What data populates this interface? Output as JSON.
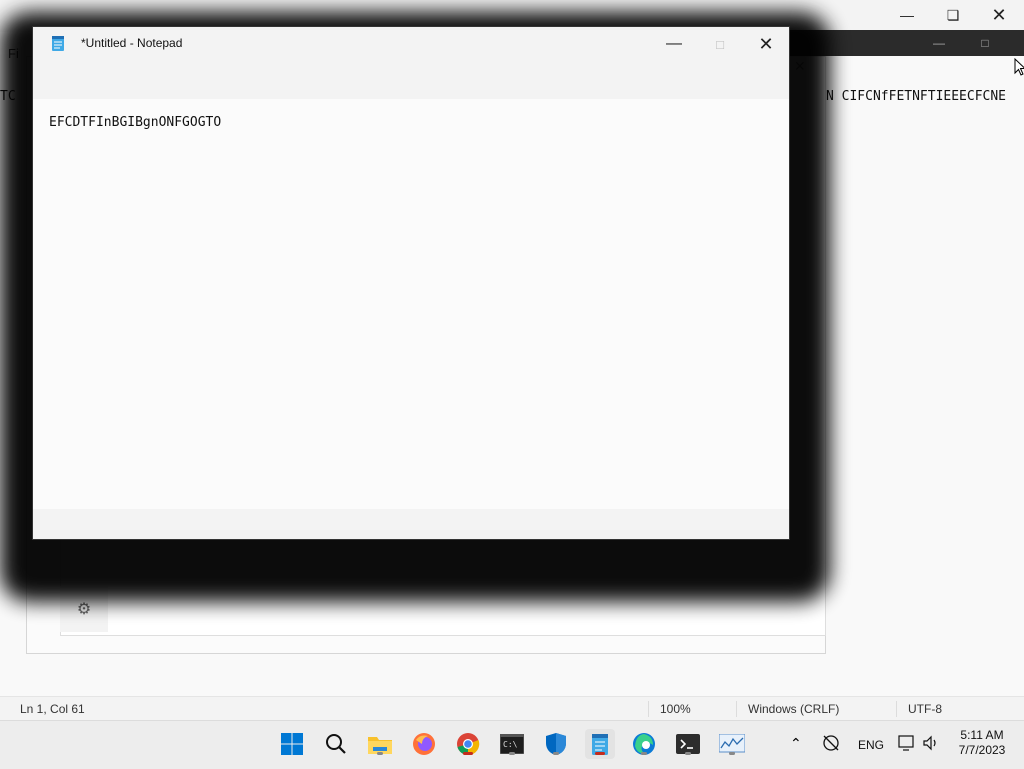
{
  "background_window": {
    "menu_fragment": "Fi",
    "text_left_fragment": "TC",
    "text_right": "N CIFCNfFETNFTIEEECFCNE",
    "status": {
      "position": "Ln 1, Col 61",
      "zoom": "100%",
      "line_ending": "Windows (CRLF)",
      "encoding": "UTF-8"
    }
  },
  "front_window": {
    "title": "*Untitled - Notepad",
    "content": "EFCDTFInBGIBgnONFGOGTO"
  },
  "taskbar": {
    "apps": [
      {
        "name": "start",
        "icon": "windows-logo-icon"
      },
      {
        "name": "search",
        "icon": "search-icon"
      },
      {
        "name": "file-explorer",
        "icon": "folder-icon"
      },
      {
        "name": "firefox",
        "icon": "firefox-icon"
      },
      {
        "name": "chrome",
        "icon": "chrome-icon"
      },
      {
        "name": "terminal-cmd",
        "icon": "cmd-icon"
      },
      {
        "name": "windows-security",
        "icon": "shield-icon"
      },
      {
        "name": "notepad",
        "icon": "notepad-icon"
      },
      {
        "name": "edge",
        "icon": "edge-icon"
      },
      {
        "name": "terminal",
        "icon": "terminal-icon"
      },
      {
        "name": "resource-monitor",
        "icon": "monitor-icon"
      }
    ],
    "tray": {
      "language": "ENG",
      "time": "5:11 AM",
      "date": "7/7/2023"
    }
  },
  "colors": {
    "accent": "#0067c0",
    "running_indicator": "#c42b1c"
  }
}
